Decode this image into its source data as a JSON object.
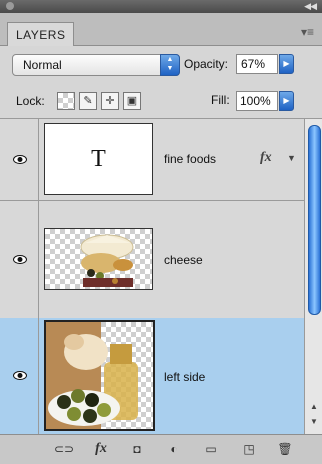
{
  "panel": {
    "tab_label": "LAYERS"
  },
  "blend": {
    "mode": "Normal"
  },
  "opacity": {
    "label": "Opacity:",
    "value": "67%"
  },
  "lock": {
    "label": "Lock:"
  },
  "fill": {
    "label": "Fill:",
    "value": "100%"
  },
  "layers": [
    {
      "name": "fine foods",
      "thumb_text": "T",
      "has_fx": true,
      "fx_label": "fx"
    },
    {
      "name": "cheese"
    },
    {
      "name": "left side",
      "selected": true
    }
  ],
  "footer": {
    "fx_label": "fx"
  },
  "colors": {
    "accent": "#2a71d6",
    "selected_row": "#a9cfee"
  }
}
